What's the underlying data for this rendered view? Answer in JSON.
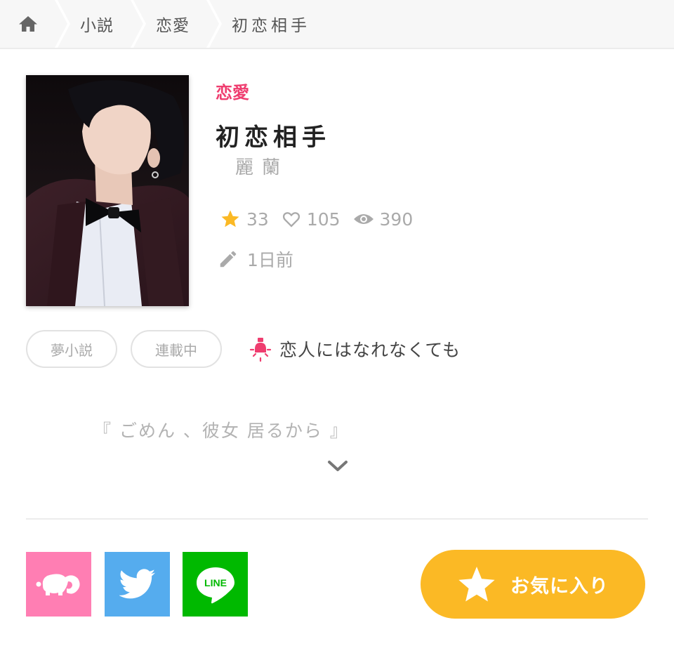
{
  "breadcrumb": {
    "home_icon": "home-icon",
    "items": [
      {
        "label": "小説"
      },
      {
        "label": "恋愛"
      },
      {
        "label": "初恋相手"
      }
    ]
  },
  "novel": {
    "category": "恋愛",
    "title": "初恋相手",
    "author": "麗蘭",
    "stats": {
      "stars": "33",
      "hearts": "105",
      "views": "390"
    },
    "updated": "1日前",
    "tags": [
      "夢小説",
      "連載中"
    ],
    "keyword": "恋人にはなれなくても",
    "description": "『 ごめん 、彼女 居るから 』"
  },
  "share": {
    "items": [
      {
        "name": "elephant-share-icon",
        "color": "#ff7eb3"
      },
      {
        "name": "twitter-icon",
        "color": "#55acee"
      },
      {
        "name": "line-icon",
        "color": "#00b900",
        "text": "LINE"
      }
    ]
  },
  "favorite_button": {
    "label": "お気に入り",
    "color": "#fbb925"
  },
  "colors": {
    "accent": "#ef3d6f",
    "star": "#fbb925",
    "muted": "#aaaaaa"
  }
}
